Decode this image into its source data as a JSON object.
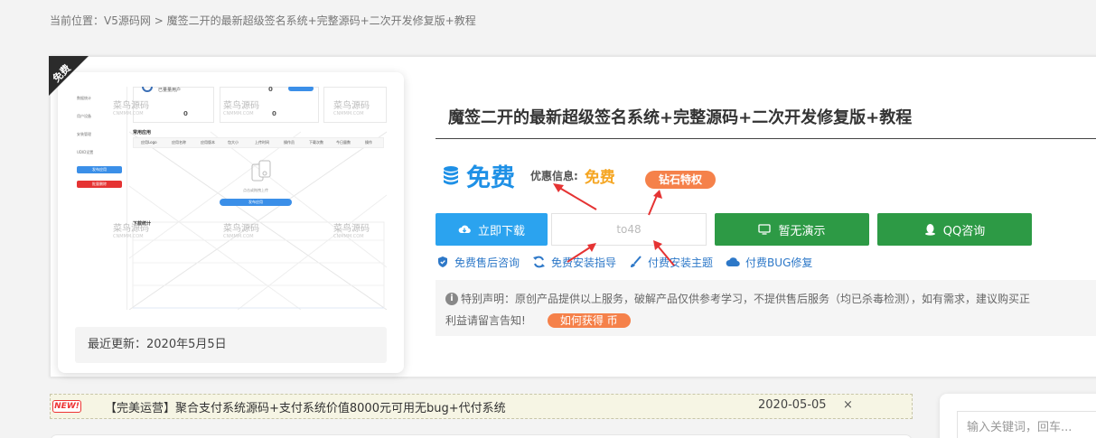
{
  "breadcrumb": {
    "prefix": "当前位置：",
    "home": "V5源码网",
    "separator": " > ",
    "current": "魔签二开的最新超级签名系统+完整源码+二次开发修复版+教程"
  },
  "ribbon": {
    "label": "免费"
  },
  "thumbnail": {
    "menu": [
      "数据统计",
      "用户设备",
      "安装管理",
      "UDID设置"
    ],
    "button_labels": [
      "发布应用",
      "批量删除"
    ],
    "section_title": "常用应用",
    "section_title_2": "下载统计",
    "stat_label": "已量量用户",
    "zero": "0",
    "upload_label": "点击或拖拽上传",
    "upload_button": "发布应用",
    "columns": [
      "应用Logo",
      "应用名称",
      "应用版本",
      "包大小",
      "上传时间",
      "操作员",
      "下载次数",
      "今日量数",
      "操作"
    ],
    "watermark": "菜鸟源码",
    "watermark_sub": "CNMMM.COM"
  },
  "update": {
    "text": "最近更新：2020年5月5日"
  },
  "product": {
    "title": "魔签二开的最新超级签名系统+完整源码+二次开发修复版+教程",
    "price": "免费",
    "promo_label": "优惠信息:",
    "promo_value": "免费",
    "diamond_badge": "钻石特权"
  },
  "actions": {
    "download": "立即下载",
    "code": "to48",
    "demo": "暂无演示",
    "qq": "QQ咨询"
  },
  "services": [
    {
      "label": "免费售后咨询",
      "icon": "shield-icon"
    },
    {
      "label": "免费安装指导",
      "icon": "refresh-icon"
    },
    {
      "label": "付费安装主题",
      "icon": "brush-icon"
    },
    {
      "label": "付费BUG修复",
      "icon": "cloud-icon"
    }
  ],
  "notice": {
    "line1": "特别声明：原创产品提供以上服务，破解产品仅供参考学习，不提供售后服务（均已杀毒检测），如有需求，建议购买正",
    "line2": "利益请留言告知!",
    "coin_button": "如何获得 币"
  },
  "news": {
    "tag": "NEW!",
    "text": "【完美运营】聚合支付系统源码+支付系统价值8000元可用无bug+代付系统",
    "date": "2020-05-05",
    "close": "×"
  },
  "search": {
    "placeholder": "输入关键词，回车..."
  },
  "colors": {
    "primary_blue": "#2ba3ef",
    "green": "#2d9a45",
    "orange": "#f5814a",
    "gold": "#f5a623",
    "price_blue": "#1e90e6",
    "link_blue": "#2d78c8"
  }
}
